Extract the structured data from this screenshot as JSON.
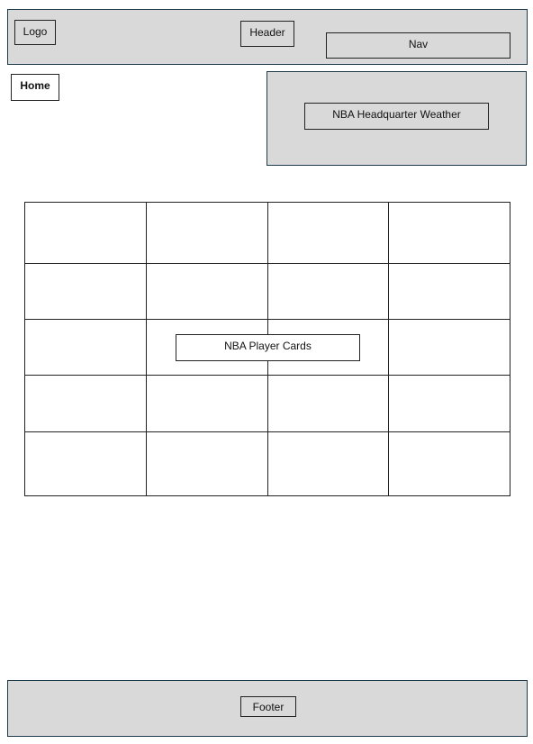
{
  "header": {
    "logo_label": "Logo",
    "header_label": "Header",
    "nav_label": "Nav"
  },
  "home_label": "Home",
  "weather": {
    "label": "NBA Headquarter Weather"
  },
  "player_cards": {
    "label": "NBA Player Cards",
    "grid_columns": 4,
    "grid_rows": 5
  },
  "footer": {
    "label": "Footer"
  }
}
